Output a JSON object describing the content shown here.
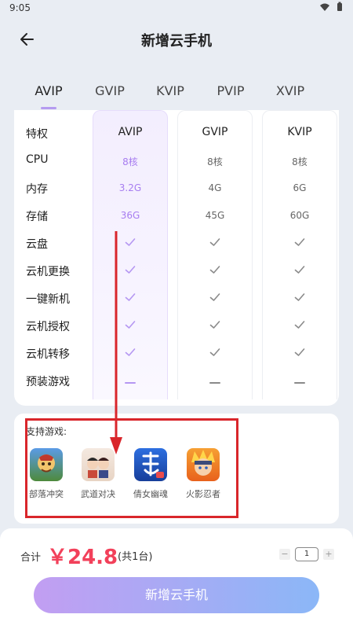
{
  "status": {
    "time": "9:05"
  },
  "header": {
    "title": "新增云手机"
  },
  "tabs": [
    {
      "label": "AVIP",
      "active": true
    },
    {
      "label": "GVIP"
    },
    {
      "label": "KVIP"
    },
    {
      "label": "PVIP"
    },
    {
      "label": "XVIP"
    }
  ],
  "table": {
    "header_label": "特权",
    "columns": [
      "AVIP",
      "GVIP",
      "KVIP"
    ],
    "rows": [
      {
        "label": "CPU",
        "values": [
          "8核",
          "8核",
          "8核"
        ]
      },
      {
        "label": "内存",
        "values": [
          "3.2G",
          "4G",
          "6G"
        ]
      },
      {
        "label": "存储",
        "values": [
          "36G",
          "45G",
          "60G"
        ]
      },
      {
        "label": "云盘",
        "values": [
          "check",
          "check",
          "check"
        ]
      },
      {
        "label": "云机更换",
        "values": [
          "check",
          "check",
          "check"
        ]
      },
      {
        "label": "一键新机",
        "values": [
          "check",
          "check",
          "check"
        ]
      },
      {
        "label": "云机授权",
        "values": [
          "check",
          "check",
          "check"
        ]
      },
      {
        "label": "云机转移",
        "values": [
          "check",
          "check",
          "check"
        ]
      },
      {
        "label": "预装游戏",
        "values": [
          "dash",
          "dash",
          "dash"
        ]
      }
    ]
  },
  "games": {
    "title": "支持游戏:",
    "items": [
      {
        "name": "部落冲突",
        "icon": "clash-of-clans-icon"
      },
      {
        "name": "武道对决",
        "icon": "martial-duel-icon"
      },
      {
        "name": "倩女幽魂",
        "icon": "qiannv-youhun-icon"
      },
      {
        "name": "火影忍者",
        "icon": "naruto-icon"
      }
    ]
  },
  "footer": {
    "total_label": "合计",
    "price": "￥24.8",
    "count_note": "(共1台)",
    "quantity": "1",
    "minus": "−",
    "plus": "+",
    "submit_label": "新增云手机"
  },
  "colors": {
    "accent_purple": "#a77df0",
    "price_red": "#f2405a",
    "annotation_red": "#d9262b"
  }
}
